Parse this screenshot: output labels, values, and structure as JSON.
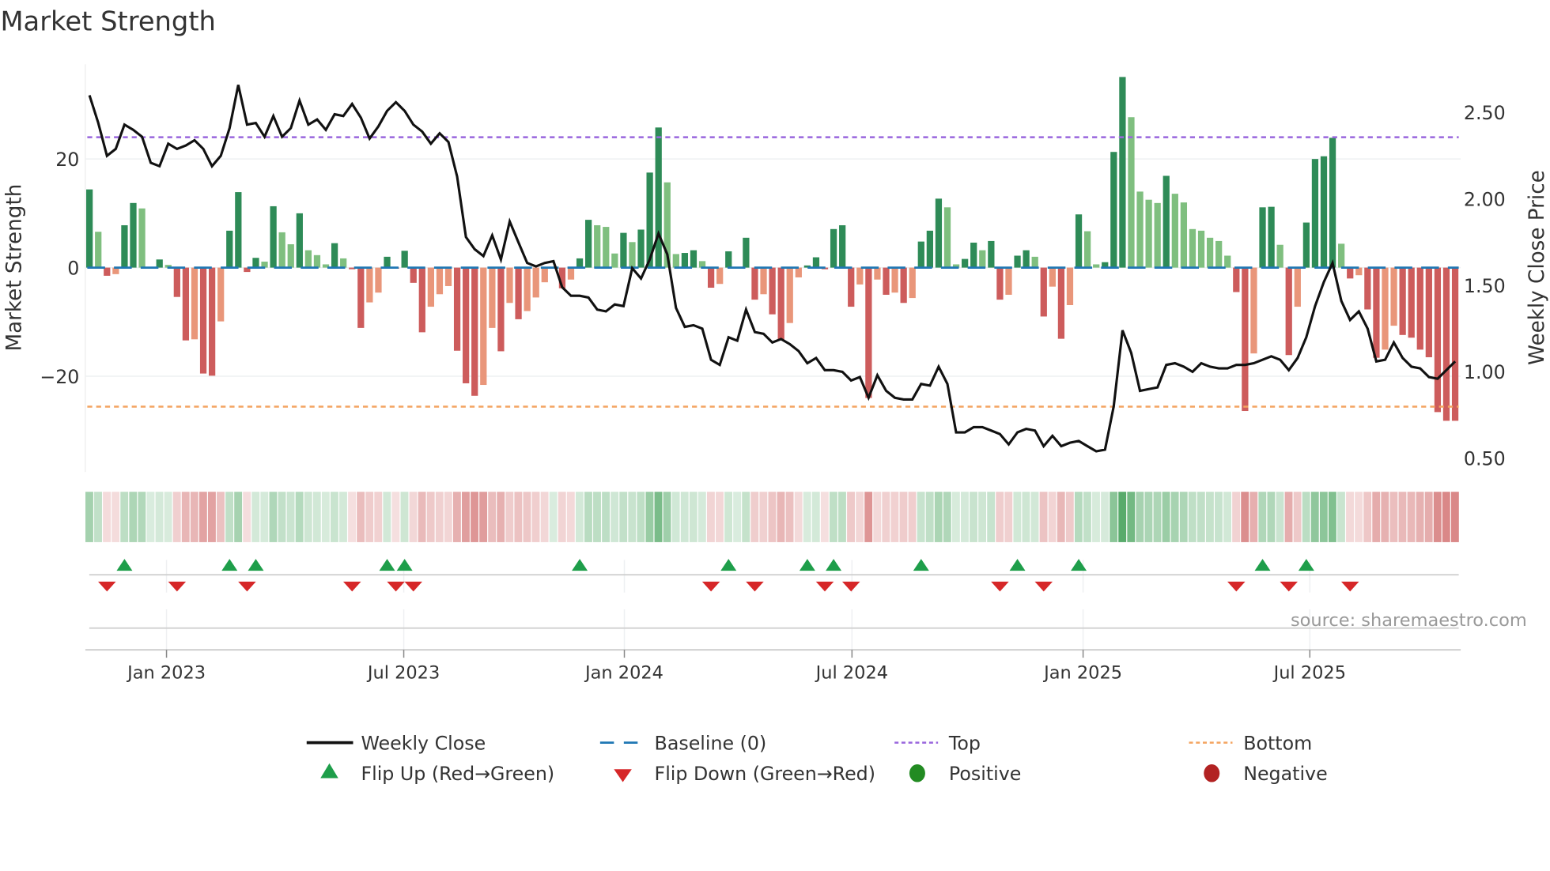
{
  "chart_data": {
    "type": "bar",
    "title": "Market Strength",
    "ylabel": "Market Strength",
    "y2label": "Weekly Close Price",
    "ylim": [
      -37,
      38
    ],
    "y2lim": [
      0.42,
      2.8
    ],
    "yticks": [
      {
        "v": 20,
        "label": "20"
      },
      {
        "v": 0,
        "label": "0"
      },
      {
        "v": -20,
        "label": "−20"
      }
    ],
    "y2ticks": [
      {
        "v": 2.5,
        "label": "2.50"
      },
      {
        "v": 2.0,
        "label": "2.00"
      },
      {
        "v": 1.5,
        "label": "1.50"
      },
      {
        "v": 1.0,
        "label": "1.00"
      },
      {
        "v": 0.5,
        "label": "0.50"
      }
    ],
    "x_unit": "week index",
    "xticks": [
      {
        "x": 8.8,
        "label": "Jan 2023"
      },
      {
        "x": 35.9,
        "label": "Jul 2023"
      },
      {
        "x": 61.1,
        "label": "Jan 2024"
      },
      {
        "x": 87.1,
        "label": "Jul 2024"
      },
      {
        "x": 113.5,
        "label": "Jan 2025"
      },
      {
        "x": 139.4,
        "label": "Jul 2025"
      }
    ],
    "top_level": 24,
    "bottom_level": -25.6,
    "baseline": 0,
    "strength": [
      14.4,
      6.6,
      -1.5,
      -1.2,
      7.8,
      11.9,
      10.9,
      0,
      1.5,
      0.5,
      -5.4,
      -13.4,
      -13.2,
      -19.5,
      -19.9,
      -9.9,
      6.8,
      13.9,
      -0.8,
      1.8,
      1.1,
      11.3,
      6.5,
      4.3,
      10.0,
      3.2,
      2.3,
      0.6,
      4.5,
      1.7,
      -0.3,
      -11.1,
      -6.4,
      -4.6,
      2.0,
      -0.2,
      3.1,
      -2.8,
      -11.9,
      -7.2,
      -4.9,
      -3.4,
      -15.3,
      -21.3,
      -23.6,
      -21.6,
      -11.1,
      -15.4,
      -6.5,
      -9.5,
      -8.0,
      -5.5,
      -2.7,
      0,
      -3.8,
      -2.2,
      1.7,
      8.8,
      7.8,
      7.5,
      2.6,
      6.4,
      4.7,
      7.0,
      17.5,
      25.8,
      15.7,
      2.5,
      2.7,
      3.2,
      1.2,
      -3.7,
      -3.0,
      3.0,
      0,
      5.5,
      -5.9,
      -4.9,
      -8.6,
      -13.4,
      -10.2,
      -1.8,
      0.4,
      1.9,
      -0.3,
      7.1,
      7.8,
      -7.2,
      -3.1,
      -24.0,
      -2.2,
      -5.0,
      -4.6,
      -6.5,
      -5.6,
      4.8,
      6.8,
      12.7,
      11.1,
      0.6,
      1.6,
      4.6,
      3.2,
      4.9,
      -5.9,
      -5.0,
      2.2,
      3.2,
      2.0,
      -9.0,
      -3.5,
      -13.1,
      -6.9,
      9.8,
      6.7,
      0.6,
      1.0,
      21.3,
      35.1,
      27.7,
      14.0,
      12.5,
      11.9,
      16.9,
      13.6,
      12.0,
      7.1,
      6.8,
      5.5,
      4.9,
      2.2,
      -4.5,
      -26.4,
      -15.8,
      11.1,
      11.2,
      4.2,
      -16.1,
      -7.2,
      8.3,
      20.0,
      20.5,
      23.9,
      4.4,
      -2.0,
      -1.4,
      -7.7,
      -16.6,
      -15.1,
      -10.7,
      -12.4,
      -12.9,
      -15.1,
      -16.5,
      -26.6,
      -28.2,
      -28.2
    ],
    "weekly_close": [
      2.6,
      2.44,
      2.25,
      2.29,
      2.43,
      2.4,
      2.36,
      2.21,
      2.19,
      2.32,
      2.29,
      2.31,
      2.34,
      2.29,
      2.19,
      2.25,
      2.41,
      2.66,
      2.43,
      2.44,
      2.36,
      2.48,
      2.36,
      2.41,
      2.57,
      2.43,
      2.46,
      2.4,
      2.49,
      2.48,
      2.55,
      2.47,
      2.35,
      2.42,
      2.51,
      2.56,
      2.51,
      2.43,
      2.39,
      2.32,
      2.38,
      2.33,
      2.13,
      1.78,
      1.71,
      1.67,
      1.79,
      1.65,
      1.87,
      1.75,
      1.63,
      1.61,
      1.63,
      1.64,
      1.49,
      1.44,
      1.44,
      1.43,
      1.36,
      1.35,
      1.39,
      1.38,
      1.6,
      1.54,
      1.65,
      1.8,
      1.68,
      1.37,
      1.26,
      1.27,
      1.25,
      1.07,
      1.04,
      1.2,
      1.18,
      1.36,
      1.23,
      1.22,
      1.17,
      1.19,
      1.16,
      1.12,
      1.05,
      1.08,
      1.01,
      1.01,
      1.0,
      0.95,
      0.97,
      0.85,
      0.98,
      0.89,
      0.85,
      0.84,
      0.84,
      0.93,
      0.92,
      1.03,
      0.93,
      0.65,
      0.65,
      0.68,
      0.68,
      0.66,
      0.64,
      0.58,
      0.65,
      0.67,
      0.66,
      0.57,
      0.63,
      0.57,
      0.59,
      0.6,
      0.57,
      0.54,
      0.55,
      0.8,
      1.24,
      1.11,
      0.89,
      0.9,
      0.91,
      1.04,
      1.05,
      1.03,
      1.0,
      1.05,
      1.03,
      1.02,
      1.02,
      1.04,
      1.04,
      1.05,
      1.07,
      1.09,
      1.07,
      1.01,
      1.08,
      1.2,
      1.38,
      1.52,
      1.63,
      1.41,
      1.3,
      1.35,
      1.25,
      1.06,
      1.07,
      1.17,
      1.08,
      1.03,
      1.02,
      0.97,
      0.96,
      1.01,
      1.06
    ],
    "flip_up": [
      4,
      16,
      19,
      34,
      36,
      56,
      73,
      82,
      85,
      95,
      106,
      113,
      134,
      139
    ],
    "flip_down": [
      2,
      10,
      18,
      30,
      35,
      37,
      71,
      76,
      84,
      87,
      104,
      109,
      131,
      137,
      144
    ],
    "legend_placement": "bottom",
    "legend": [
      {
        "key": "close",
        "label": "Weekly Close"
      },
      {
        "key": "baseline",
        "label": "Baseline (0)"
      },
      {
        "key": "top",
        "label": "Top"
      },
      {
        "key": "bottom",
        "label": "Bottom"
      },
      {
        "key": "flipup",
        "label": "Flip Up (Red→Green)"
      },
      {
        "key": "flipdown",
        "label": "Flip Down (Green→Red)"
      },
      {
        "key": "positive",
        "label": "Positive"
      },
      {
        "key": "negative",
        "label": "Negative"
      }
    ],
    "source": "source: sharemaestro.com"
  },
  "colors": {
    "pos_strong": "#2e8b57",
    "pos_weak": "#7fbf7f",
    "neg_strong": "#cd5c5c",
    "neg_weak": "#e9967a",
    "close": "#111111",
    "baseline": "#1f77b4",
    "top": "#9966dd",
    "bottom": "#f4a460",
    "flip_up": "#1e9e4a",
    "flip_down": "#d62728",
    "positive": "#228b22",
    "negative": "#b22222"
  }
}
